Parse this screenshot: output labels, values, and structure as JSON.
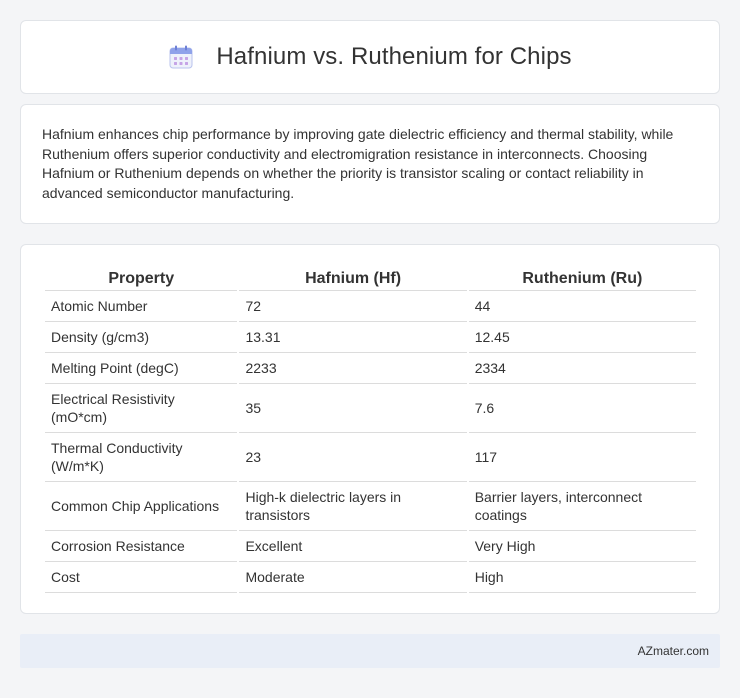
{
  "header": {
    "title": "Hafnium vs. Ruthenium for Chips",
    "icon": "calendar-icon"
  },
  "intro": {
    "text": "Hafnium enhances chip performance by improving gate dielectric efficiency and thermal stability, while Ruthenium offers superior conductivity and electromigration resistance in interconnects. Choosing Hafnium or Ruthenium depends on whether the priority is transistor scaling or contact reliability in advanced semiconductor manufacturing."
  },
  "table": {
    "headers": [
      "Property",
      "Hafnium (Hf)",
      "Ruthenium (Ru)"
    ],
    "rows": [
      [
        "Atomic Number",
        "72",
        "44"
      ],
      [
        "Density (g/cm3)",
        "13.31",
        "12.45"
      ],
      [
        "Melting Point (degC)",
        "2233",
        "2334"
      ],
      [
        "Electrical Resistivity (mO*cm)",
        "35",
        "7.6"
      ],
      [
        "Thermal Conductivity (W/m*K)",
        "23",
        "117"
      ],
      [
        "Common Chip Applications",
        "High-k dielectric layers in transistors",
        "Barrier layers, interconnect coatings"
      ],
      [
        "Corrosion Resistance",
        "Excellent",
        "Very High"
      ],
      [
        "Cost",
        "Moderate",
        "High"
      ]
    ]
  },
  "footer": {
    "text": "AZmater.com"
  },
  "colors": {
    "page_bg": "#f4f5f7",
    "card_bg": "#ffffff",
    "footer_bg": "#e9eef7",
    "icon_accent": "#7a8fe0"
  }
}
